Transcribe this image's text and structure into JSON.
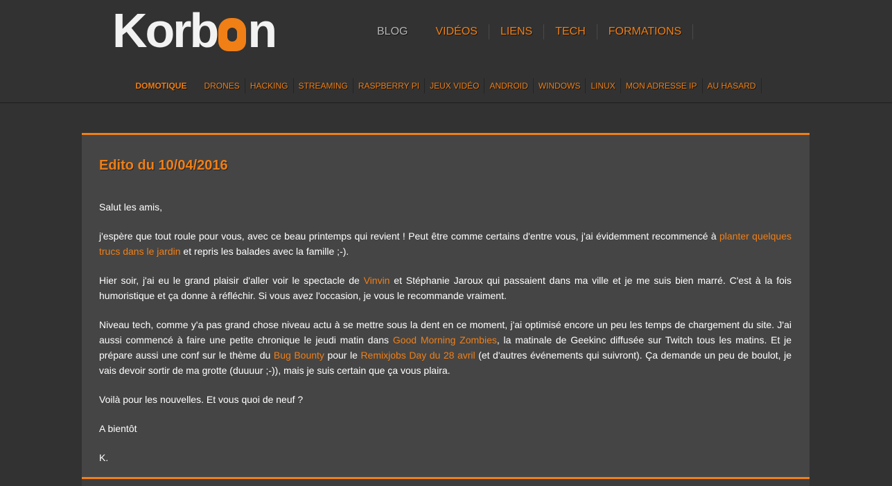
{
  "header": {
    "logo": {
      "text_before": "Korb",
      "text_after": "n"
    },
    "main_nav": [
      "BLOG",
      "VIDÉOS",
      "LIENS",
      "TECH",
      "FORMATIONS"
    ],
    "sub_nav": [
      "DOMOTIQUE",
      "DRONES",
      "HACKING",
      "STREAMING",
      "RASPBERRY PI",
      "JEUX VIDÉO",
      "ANDROID",
      "WINDOWS",
      "LINUX",
      "MON ADRESSE IP",
      "AU HASARD"
    ]
  },
  "article": {
    "title": "Edito du 10/04/2016",
    "p1": "Salut les amis,",
    "p2": {
      "t1": "j'espère que tout roule pour vous, avec ce beau printemps qui revient ! Peut être comme certains d'entre vous, j'ai évidemment recommencé à ",
      "l1": "planter quelques trucs dans le jardin",
      "t2": " et repris les balades avec la famille ;-)."
    },
    "p3": {
      "t1": "Hier soir, j'ai eu le grand plaisir d'aller voir le spectacle de ",
      "l1": "Vinvin",
      "t2": " et Stéphanie Jaroux qui passaient dans ma ville et je me suis bien marré. C'est à la fois humoristique et ça donne à réfléchir. Si vous avez l'occasion, je vous le recommande vraiment."
    },
    "p4": {
      "t1": "Niveau tech, comme y'a pas grand chose niveau actu à se mettre sous la dent en ce moment, j'ai optimisé encore un peu les temps de chargement du site. J'ai aussi commencé à faire une petite chronique le jeudi matin dans ",
      "l1": "Good Morning Zombies",
      "t2": ", la matinale de Geekinc diffusée sur Twitch tous les matins. Et je prépare aussi une conf sur le thème du ",
      "l2": "Bug Bounty",
      "t3": " pour le ",
      "l3": "Remixjobs Day du 28 avril",
      "t4": " (et d'autres événements qui suivront). Ça demande un peu de boulot, je vais devoir sortir de ma grotte (duuuur ;-)), mais je suis certain que ça vous plaira."
    },
    "p5": "Voilà pour les nouvelles. Et vous quoi de neuf ?",
    "p6": "A bientôt",
    "p7": "K."
  },
  "colors": {
    "accent": "#f07f16",
    "background": "#323232",
    "panel": "#454545"
  }
}
